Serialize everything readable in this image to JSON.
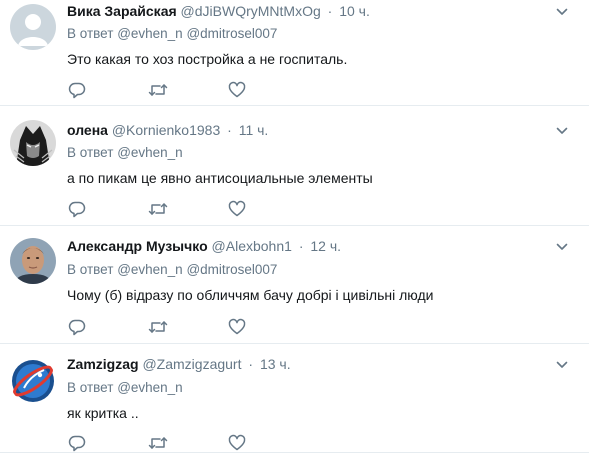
{
  "colors": {
    "secondary_text": "#657786",
    "primary_text": "#14171a",
    "divider": "#e6ecf0"
  },
  "tweets": [
    {
      "display_name": "Вика Зарайская",
      "handle": "@dJiBWQryMNtMxOg",
      "separator": "·",
      "time": "10 ч.",
      "reply_prefix": "В ответ",
      "reply_mentions": "@evhen_n @dmitrosel007",
      "text": "Это какая то хоз постройка а не госпиталь.",
      "avatar_icon": "default-profile-icon"
    },
    {
      "display_name": "олена",
      "handle": "@Kornienko1983",
      "separator": "·",
      "time": "11 ч.",
      "reply_prefix": "В ответ",
      "reply_mentions": "@evhen_n",
      "text": "а по пикам це явно антисоциальные элементы",
      "avatar_icon": "wolverine-avatar-icon"
    },
    {
      "display_name": "Александр Музычко",
      "handle": "@Alexbohn1",
      "separator": "·",
      "time": "12 ч.",
      "reply_prefix": "В ответ",
      "reply_mentions": "@evhen_n @dmitrosel007",
      "text": "Чому (б) відразу по обличчям бачу добрі і цивільні люди",
      "avatar_icon": "man-photo-avatar-icon"
    },
    {
      "display_name": "Zamzigzag",
      "handle": "@Zamzigzagurt",
      "separator": "·",
      "time": "13 ч.",
      "reply_prefix": "В ответ",
      "reply_mentions": "@evhen_n",
      "text": "як критка ..",
      "avatar_icon": "planet-express-logo-icon"
    }
  ]
}
